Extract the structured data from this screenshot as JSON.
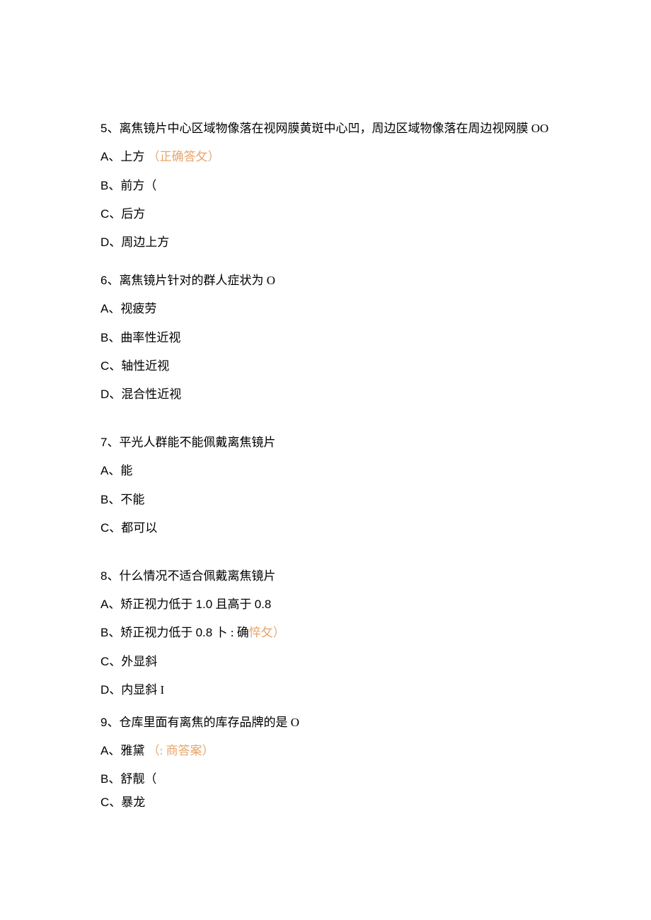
{
  "questions": [
    {
      "number": "5",
      "text": "、离焦镜片中心区域物像落在视网膜黄斑中心凹，周边区域物像落在周边视网膜 OO",
      "options": [
        {
          "letter": "A",
          "text": "、上方 ",
          "note": "（正确答攵）",
          "note_orange": true
        },
        {
          "letter": "B",
          "text": "、前方（"
        },
        {
          "letter": "C",
          "text": "、后方"
        },
        {
          "letter": "D",
          "text": "、周边上方"
        }
      ]
    },
    {
      "number": "6",
      "text": "、离焦镜片针对的群人症状为 O",
      "options": [
        {
          "letter": "A",
          "text": "、视疲劳"
        },
        {
          "letter": "B",
          "text": "、曲率性近视"
        },
        {
          "letter": "C",
          "text": "、轴性近视"
        },
        {
          "letter": "D",
          "text": "、混合性近视"
        }
      ]
    },
    {
      "number": "7",
      "text": "、平光人群能不能佩戴离焦镜片",
      "options": [
        {
          "letter": "A",
          "text": "、能"
        },
        {
          "letter": "B",
          "text": "、不能"
        },
        {
          "letter": "C",
          "text": "、都可以"
        }
      ]
    },
    {
      "number": "8",
      "text": "、什么情况不适合佩戴离焦镜片",
      "options": [
        {
          "letter": "A",
          "text": "、矫正视力低于 1.0 且高于 0.8",
          "latin_nums": true
        },
        {
          "letter": "B",
          "text_pre": "、矫正视力低于 0.8 卜 : 确",
          "note": "悴攵）",
          "latin_nums": true,
          "note_orange": true
        },
        {
          "letter": "C",
          "text": "、外显斜"
        },
        {
          "letter": "D",
          "text": "、内显斜 I"
        }
      ]
    },
    {
      "number": "9",
      "text": "、仓库里面有离焦的库存品牌的是 O",
      "options": [
        {
          "letter": "A",
          "text": "、雅黛 ",
          "note": "（: 商答案）",
          "note_orange": true
        },
        {
          "letter": "B",
          "text": "、舒靓（"
        },
        {
          "letter": "C",
          "text": "、暴龙"
        }
      ]
    }
  ]
}
